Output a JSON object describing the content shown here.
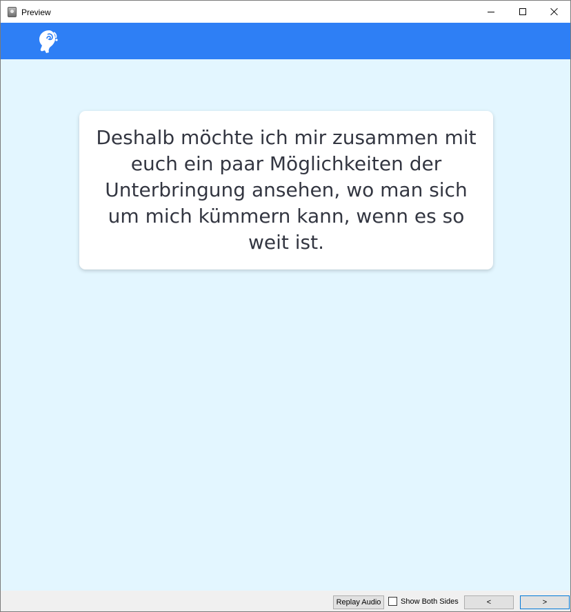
{
  "window": {
    "title": "Preview",
    "icon": "app-icon",
    "controls": {
      "minimize_icon": "minimize-icon",
      "maximize_icon": "maximize-icon",
      "close_icon": "close-icon"
    }
  },
  "header": {
    "background_color": "#2e7ff5",
    "logo_icon": "head-profile-logo-icon"
  },
  "content": {
    "background_color": "#e3f6ff",
    "card_text": "Deshalb möchte ich mir zusammen mit euch ein paar Möglichkeiten der Unterbringung ansehen, wo man sich um mich kümmern kann, wenn es so weit ist."
  },
  "toolbar": {
    "replay_label": "Replay Audio",
    "show_both_sides_label": "Show Both Sides",
    "show_both_sides_checked": false,
    "prev_label": "<",
    "next_label": ">"
  }
}
